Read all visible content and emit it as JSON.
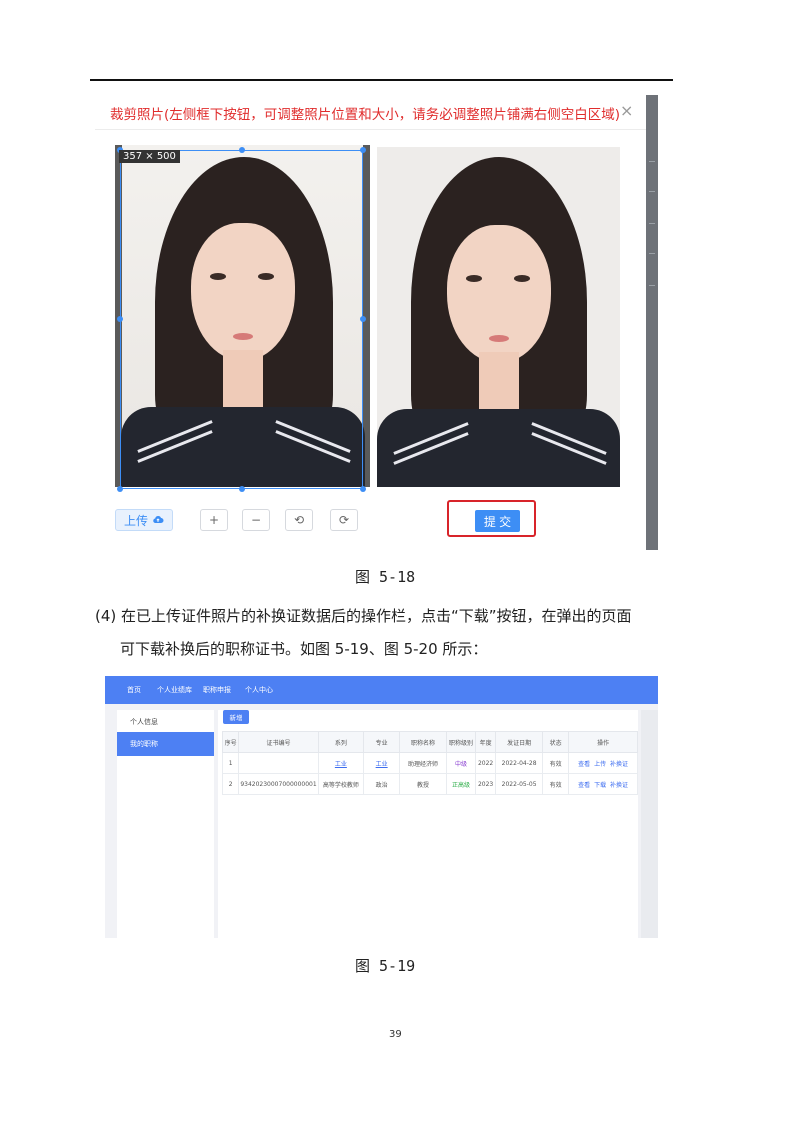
{
  "figure_5_18": {
    "dialog_title": "裁剪照片(左侧框下按钮，可调整照片位置和大小，请务必调整照片铺满右侧空白区域)",
    "close_label": "×",
    "size_tag": "357 × 500",
    "upload_label": "上传",
    "zoom_in_label": "+",
    "zoom_out_label": "−",
    "rotate_left_label": "⟲",
    "rotate_right_label": "⟳",
    "submit_label": "提 交",
    "caption": "图 5-18"
  },
  "paragraph": {
    "line1": "(4) 在已上传证件照片的补换证数据后的操作栏，点击“下载”按钮，在弹出的页面",
    "line2": "可下载补换后的职称证书。如图 5-19、图 5-20 所示："
  },
  "figure_5_19": {
    "nav": [
      "首页",
      "个人业绩库",
      "职称申报",
      "个人中心"
    ],
    "sidebar": [
      "个人信息",
      "我的职称"
    ],
    "new_button": "新增",
    "table": {
      "headers": [
        "序号",
        "证书编号",
        "系列",
        "专业",
        "职称名称",
        "职称级别",
        "年度",
        "发证日期",
        "状态",
        "操作"
      ],
      "rows": [
        {
          "no": "1",
          "cert_no": "",
          "series": "工业",
          "major": "工业",
          "title": "助理经济师",
          "level": "中级",
          "year": "2022",
          "date": "2022-04-28",
          "status": "有效",
          "actions": [
            "查看",
            "上传",
            "补换证"
          ]
        },
        {
          "no": "2",
          "cert_no": "93420230007000000001",
          "series": "高等学校教师",
          "major": "政治",
          "title": "教授",
          "level": "正高级",
          "year": "2023",
          "date": "2022-05-05",
          "status": "有效",
          "actions": [
            "查看",
            "下载",
            "补换证"
          ]
        }
      ]
    },
    "caption": "图 5-19"
  },
  "page_number": "39",
  "colors": {
    "accent": "#4d80f3",
    "highlight_red": "#d8242a",
    "title_red": "#e02d2d"
  }
}
